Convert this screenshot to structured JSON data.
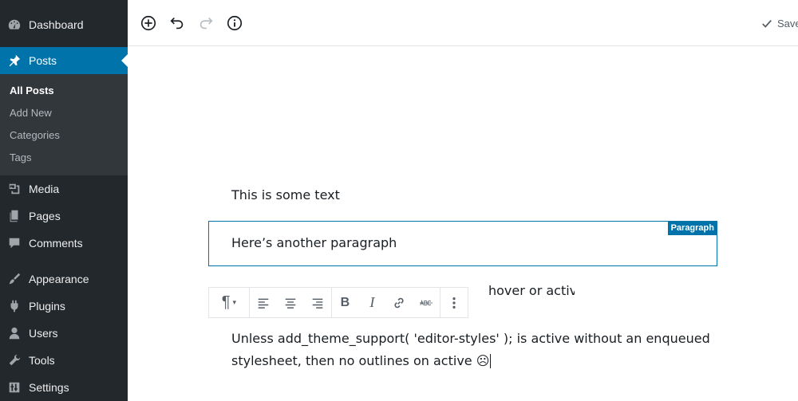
{
  "sidebar": {
    "dashboard": "Dashboard",
    "posts": "Posts",
    "submenu": [
      "All Posts",
      "Add New",
      "Categories",
      "Tags"
    ],
    "media": "Media",
    "pages": "Pages",
    "comments": "Comments",
    "appearance": "Appearance",
    "plugins": "Plugins",
    "users": "Users",
    "tools": "Tools",
    "settings": "Settings"
  },
  "topbar": {
    "saved_label": "Saved"
  },
  "editor": {
    "p1": "This is some text",
    "p2": "Here’s another paragraph",
    "block_label": "Paragraph",
    "p3": "hover or active.",
    "p4_line1": "Unless add_theme_support( 'editor-styles' ); is active without an enqueued",
    "p4_line2": "stylesheet, then no outlines on active ☹"
  },
  "colors": {
    "accent": "#0073aa",
    "sidebar_bg": "#23282d",
    "submenu_bg": "#32373c"
  }
}
